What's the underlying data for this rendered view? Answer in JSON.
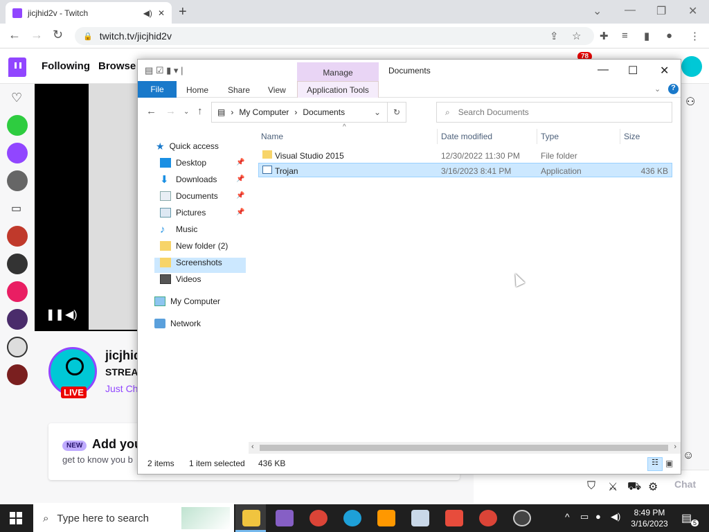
{
  "browser": {
    "tab_title": "jicjhid2v - Twitch",
    "url": "twitch.tv/jicjhid2v"
  },
  "twitch": {
    "nav_following": "Following",
    "nav_browse": "Browse",
    "notif_count": "78",
    "channel_name": "jicjhid",
    "streaming_text": "STREA",
    "category": "Just Ch",
    "live_label": "LIVE",
    "new_label": "NEW",
    "card_title": "Add you",
    "card_text": "get to know you b",
    "chat_button": "Chat"
  },
  "explorer": {
    "window_title": "Documents",
    "manage_tab": "Manage",
    "ribbon": {
      "file": "File",
      "home": "Home",
      "share": "Share",
      "view": "View",
      "app_tools": "Application Tools"
    },
    "address": {
      "root": "My Computer",
      "current": "Documents"
    },
    "search_placeholder": "Search Documents",
    "nav_pane": {
      "quick_access": "Quick access",
      "desktop": "Desktop",
      "downloads": "Downloads",
      "documents": "Documents",
      "pictures": "Pictures",
      "music": "Music",
      "new_folder": "New folder (2)",
      "screenshots": "Screenshots",
      "videos": "Videos",
      "my_computer": "My Computer",
      "network": "Network"
    },
    "columns": {
      "name": "Name",
      "date": "Date modified",
      "type": "Type",
      "size": "Size"
    },
    "files": [
      {
        "name": "Visual Studio 2015",
        "date": "12/30/2022 11:30 PM",
        "type": "File folder",
        "size": ""
      },
      {
        "name": "Trojan",
        "date": "3/16/2023 8:41 PM",
        "type": "Application",
        "size": "436 KB"
      }
    ],
    "status": {
      "items": "2 items",
      "selected": "1 item selected",
      "size": "436 KB"
    }
  },
  "taskbar": {
    "search_placeholder": "Type here to search",
    "time": "8:49 PM",
    "date": "3/16/2023",
    "notif_count": "5"
  },
  "colors": {
    "twitch_purple": "#9146ff",
    "explorer_file_tab": "#1979ca",
    "selection": "#cce8ff"
  }
}
